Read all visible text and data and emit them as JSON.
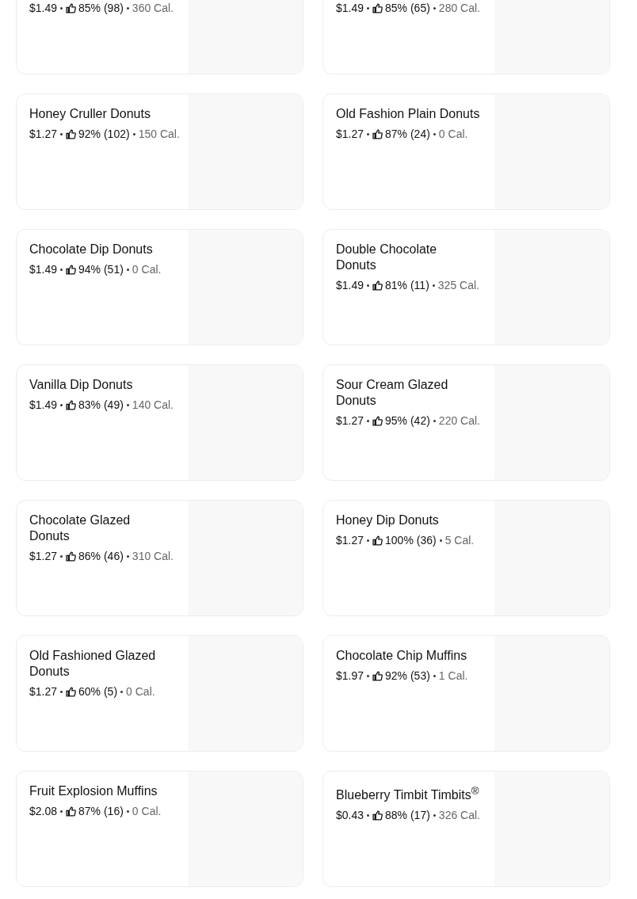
{
  "items": [
    {
      "price": "$1.49",
      "rating": "85% (98)",
      "calories": "360 Cal."
    },
    {
      "price": "$1.49",
      "rating": "85% (65)",
      "calories": "280 Cal."
    },
    {
      "name": "Honey Cruller Donuts",
      "price": "$1.27",
      "rating": "92% (102)",
      "calories": "150 Cal."
    },
    {
      "name": "Old Fashion Plain Donuts",
      "price": "$1.27",
      "rating": "87% (24)",
      "calories": "0 Cal."
    },
    {
      "name": "Chocolate Dip Donuts",
      "price": "$1.49",
      "rating": "94% (51)",
      "calories": "0 Cal."
    },
    {
      "name": "Double Chocolate Donuts",
      "price": "$1.49",
      "rating": "81% (11)",
      "calories": "325 Cal."
    },
    {
      "name": "Vanilla Dip Donuts",
      "price": "$1.49",
      "rating": "83% (49)",
      "calories": "140 Cal."
    },
    {
      "name": "Sour Cream Glazed Donuts",
      "price": "$1.27",
      "rating": "95% (42)",
      "calories": "220 Cal."
    },
    {
      "name": "Chocolate Glazed Donuts",
      "price": "$1.27",
      "rating": "86% (46)",
      "calories": "310 Cal."
    },
    {
      "name": "Honey Dip Donuts",
      "price": "$1.27",
      "rating": "100% (36)",
      "calories": "5 Cal."
    },
    {
      "name": "Old Fashioned Glazed Donuts",
      "price": "$1.27",
      "rating": "60% (5)",
      "calories": "0 Cal."
    },
    {
      "name": "Chocolate Chip Muffins",
      "price": "$1.97",
      "rating": "92% (53)",
      "calories": "1 Cal."
    },
    {
      "name": "Fruit Explosion Muffins",
      "price": "$2.08",
      "rating": "87% (16)",
      "calories": "0 Cal."
    },
    {
      "name": "Blueberry Timbit Timbits$^{®}$",
      "price": "$0.43",
      "rating": "88% (17)",
      "calories": "326 Cal."
    }
  ]
}
